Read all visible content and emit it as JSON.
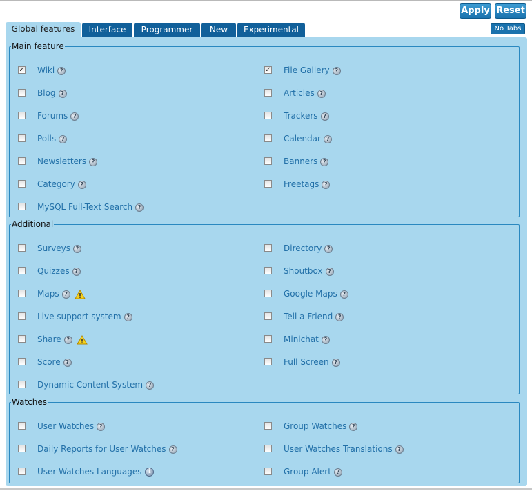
{
  "actions": {
    "apply": "Apply",
    "reset": "Reset",
    "no_tabs": "No Tabs"
  },
  "tabs": [
    "Global features",
    "Interface",
    "Programmer",
    "New",
    "Experimental"
  ],
  "active_tab": "Global features",
  "sections": [
    {
      "legend": "Main feature",
      "items": [
        {
          "label": "Wiki",
          "checked": true,
          "icon": "help-icon"
        },
        {
          "label": "File Gallery",
          "checked": true,
          "icon": "help-icon"
        },
        {
          "label": "Blog",
          "checked": false,
          "icon": "help-icon"
        },
        {
          "label": "Articles",
          "checked": false,
          "icon": "help-icon"
        },
        {
          "label": "Forums",
          "checked": false,
          "icon": "help-icon"
        },
        {
          "label": "Trackers",
          "checked": false,
          "icon": "help-icon"
        },
        {
          "label": "Polls",
          "checked": false,
          "icon": "help-icon"
        },
        {
          "label": "Calendar",
          "checked": false,
          "icon": "help-icon"
        },
        {
          "label": "Newsletters",
          "checked": false,
          "icon": "help-icon"
        },
        {
          "label": "Banners",
          "checked": false,
          "icon": "help-icon"
        },
        {
          "label": "Category",
          "checked": false,
          "icon": "help-icon"
        },
        {
          "label": "Freetags",
          "checked": false,
          "icon": "help-icon"
        },
        {
          "label": "MySQL Full-Text Search",
          "checked": false,
          "icon": "help-icon"
        }
      ]
    },
    {
      "legend": "Additional",
      "items": [
        {
          "label": "Surveys",
          "checked": false,
          "icon": "help-icon"
        },
        {
          "label": "Directory",
          "checked": false,
          "icon": "help-icon"
        },
        {
          "label": "Quizzes",
          "checked": false,
          "icon": "help-icon"
        },
        {
          "label": "Shoutbox",
          "checked": false,
          "icon": "help-icon"
        },
        {
          "label": "Maps",
          "checked": false,
          "icon": "help-icon",
          "warning": true
        },
        {
          "label": "Google Maps",
          "checked": false,
          "icon": "help-icon"
        },
        {
          "label": "Live support system",
          "checked": false,
          "icon": "help-icon"
        },
        {
          "label": "Tell a Friend",
          "checked": false,
          "icon": "help-icon"
        },
        {
          "label": "Share",
          "checked": false,
          "icon": "help-icon",
          "warning": true
        },
        {
          "label": "Minichat",
          "checked": false,
          "icon": "help-icon"
        },
        {
          "label": "Score",
          "checked": false,
          "icon": "help-icon"
        },
        {
          "label": "Full Screen",
          "checked": false,
          "icon": "help-icon"
        },
        {
          "label": "Dynamic Content System",
          "checked": false,
          "icon": "help-icon"
        }
      ]
    },
    {
      "legend": "Watches",
      "items": [
        {
          "label": "User Watches",
          "checked": false,
          "icon": "help-icon"
        },
        {
          "label": "Group Watches",
          "checked": false,
          "icon": "help-icon"
        },
        {
          "label": "Daily Reports for User Watches",
          "checked": false,
          "icon": "help-icon"
        },
        {
          "label": "User Watches Translations",
          "checked": false,
          "icon": "help-icon"
        },
        {
          "label": "User Watches Languages",
          "checked": false,
          "icon": "info-icon"
        },
        {
          "label": "Group Alert",
          "checked": false,
          "icon": "help-icon"
        }
      ]
    }
  ]
}
